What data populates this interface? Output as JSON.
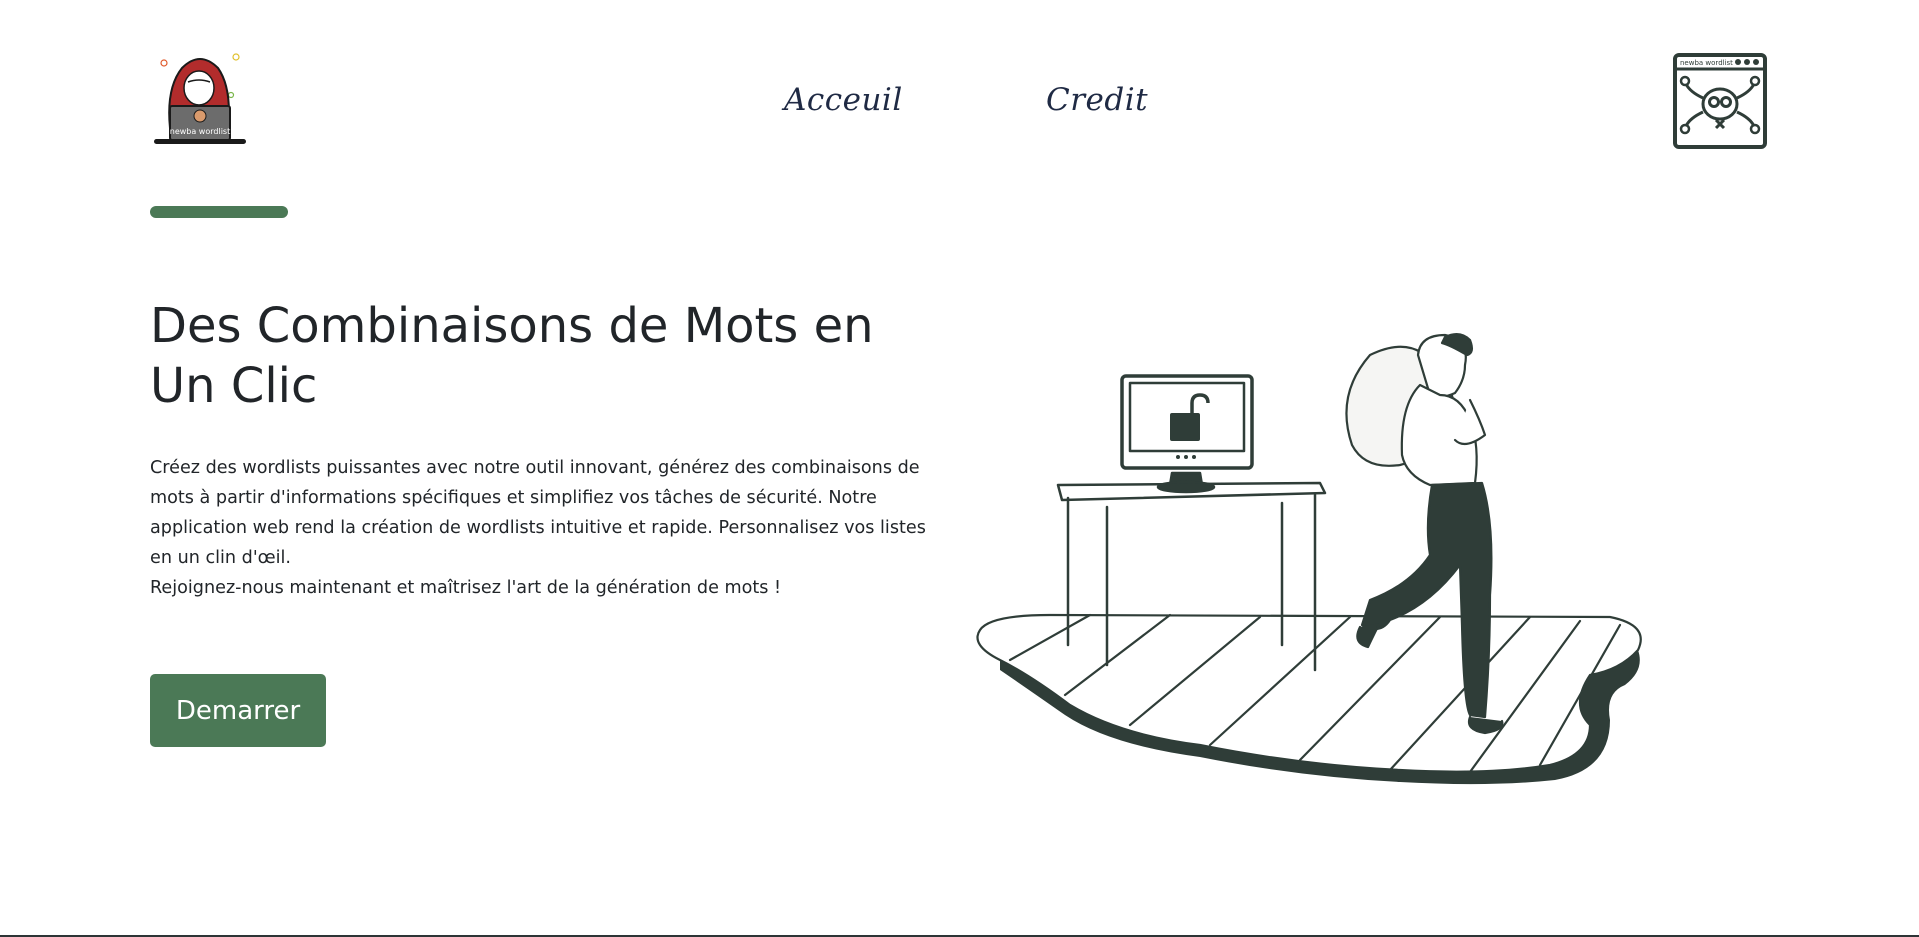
{
  "colors": {
    "accent": "#4b7956",
    "ink": "#2f3d38",
    "text": "#212529",
    "logo_red": "#b22c2c"
  },
  "header": {
    "logo_icon": "hacker-laptop-logo-icon",
    "logo_laptop_text": "newba wordlist",
    "nav": [
      {
        "label": "Acceuil"
      },
      {
        "label": "Credit"
      }
    ],
    "corner_icon": "skull-browser-window-icon",
    "corner_window_text": "newba wordlist"
  },
  "hero": {
    "title": "Des Combinaisons de Mots en Un Clic",
    "description_lines": [
      "Créez des wordlists puissantes avec notre outil innovant, générez des combinaisons de mots à partir d'informations spécifiques et simplifiez vos tâches de sécurité. Notre application web rend la création de wordlists intuitive et rapide. Personnalisez vos listes en un clin d'œil.",
      "Rejoignez-nous maintenant et maîtrisez l'art de la génération de mots !"
    ],
    "cta_label": "Demarrer",
    "illustration": "thief-stealing-from-computer-illustration"
  }
}
